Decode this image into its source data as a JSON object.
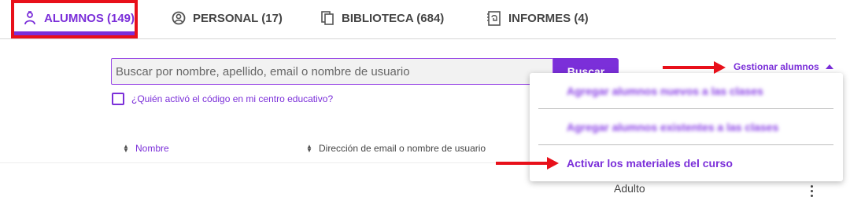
{
  "tabs": [
    {
      "label": "ALUMNOS (149)",
      "icon": "student-icon",
      "active": true
    },
    {
      "label": "PERSONAL (17)",
      "icon": "person-circle-icon",
      "active": false
    },
    {
      "label": "BIBLIOTECA (684)",
      "icon": "library-pages-icon",
      "active": false
    },
    {
      "label": "INFORMES (4)",
      "icon": "report-icon",
      "active": false
    }
  ],
  "search": {
    "placeholder": "Buscar por nombre, apellido, email o nombre de usuario",
    "button_label": "Buscar"
  },
  "code_check": {
    "label": "¿Quién activó el código en mi centro educativo?",
    "checked": false
  },
  "columns": [
    {
      "label": "Nombre"
    },
    {
      "label": "Dirección de email o nombre de usuario"
    }
  ],
  "rows": [
    {
      "type_text": "Adulto"
    }
  ],
  "manage": {
    "label": "Gestionar alumnos",
    "menu": [
      {
        "label": "Agregar alumnos nuevos a las clases",
        "blurred": true
      },
      {
        "label": "Agregar alumnos existentes a las clases",
        "blurred": true
      },
      {
        "label": "Activar los materiales del curso",
        "blurred": false
      }
    ]
  },
  "colors": {
    "accent": "#7b2fd9",
    "annotation": "#e8101a"
  }
}
